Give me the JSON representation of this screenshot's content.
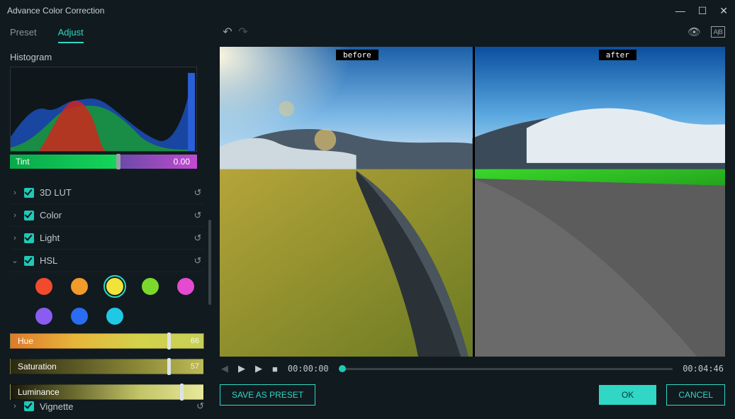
{
  "window": {
    "title": "Advance Color Correction"
  },
  "tabs": {
    "preset": "Preset",
    "adjust": "Adjust"
  },
  "sidebar": {
    "histogram_label": "Histogram",
    "tint_label": "Tint",
    "tint_value": "0.00",
    "groups": {
      "lut": {
        "label": "3D LUT",
        "expanded": false,
        "checked": true
      },
      "color": {
        "label": "Color",
        "expanded": false,
        "checked": true
      },
      "light": {
        "label": "Light",
        "expanded": false,
        "checked": true
      },
      "hsl": {
        "label": "HSL",
        "expanded": true,
        "checked": true
      }
    },
    "hsl": {
      "swatches": [
        "#f24a2e",
        "#f29a2a",
        "#f2e33a",
        "#7ad92a",
        "#e64ad0",
        "#8a5cf2",
        "#2a6cf2",
        "#1fc9e6"
      ],
      "selected_swatch_index": 2,
      "hue": {
        "label": "Hue",
        "value": "66"
      },
      "saturation": {
        "label": "Saturation",
        "value": "57"
      },
      "luminance": {
        "label": "Luminance",
        "value": ""
      }
    },
    "vignette": {
      "label": "Vignette",
      "checked": true
    }
  },
  "preview": {
    "before_label": "before",
    "after_label": "after"
  },
  "transport": {
    "current": "00:00:00",
    "duration": "00:04:46"
  },
  "footer": {
    "save_preset": "SAVE AS PRESET",
    "ok": "OK",
    "cancel": "CANCEL"
  },
  "icons": {
    "minimize": "—",
    "maximize": "☐",
    "close": "✕",
    "undo": "↶",
    "redo": "↷",
    "eye": "👁",
    "compare": "A|B",
    "reset": "↺",
    "caret_right": "›",
    "caret_down": "⌄",
    "prev": "◀",
    "play": "▶",
    "next": "▶",
    "stop": "■"
  }
}
